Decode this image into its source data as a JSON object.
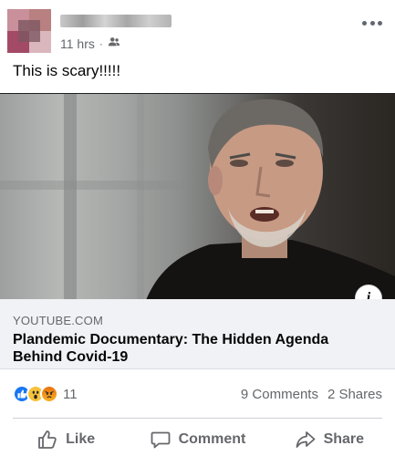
{
  "post": {
    "time": "11 hrs",
    "separator": "·",
    "audience_icon": "friends-icon",
    "text": "This is scary!!!!!"
  },
  "link": {
    "domain": "YOUTUBE.COM",
    "title": "Plandemic Documentary: The Hidden Agenda Behind Covid-19",
    "info_label": "i"
  },
  "stats": {
    "reaction_icons": [
      "like-reaction-icon",
      "wow-reaction-icon",
      "angry-reaction-icon"
    ],
    "reaction_count": "11",
    "comments": "9 Comments",
    "shares": "2 Shares"
  },
  "actions": {
    "like": "Like",
    "comment": "Comment",
    "share": "Share"
  },
  "colors": {
    "brand_blue": "#1877f2",
    "secondary_text": "#65676b",
    "link_bg": "#f0f2f5"
  }
}
